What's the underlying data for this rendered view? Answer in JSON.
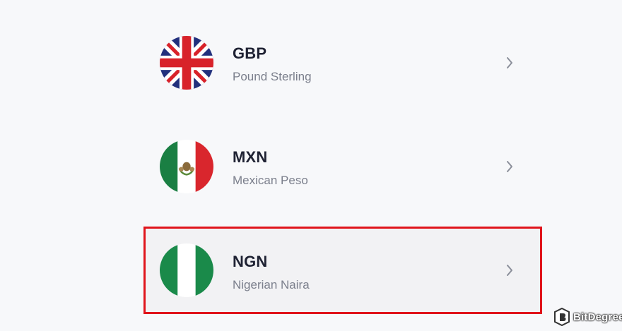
{
  "currencies": [
    {
      "code": "GBP",
      "name": "Pound Sterling",
      "flag_icon": "uk-flag-icon"
    },
    {
      "code": "MXN",
      "name": "Mexican Peso",
      "flag_icon": "mexico-flag-icon"
    },
    {
      "code": "NGN",
      "name": "Nigerian Naira",
      "flag_icon": "nigeria-flag-icon",
      "selected": true
    }
  ],
  "highlight_color": "#e0141b",
  "watermark": {
    "text": "BitDegree",
    "icon": "bitdegree-logo-icon"
  }
}
